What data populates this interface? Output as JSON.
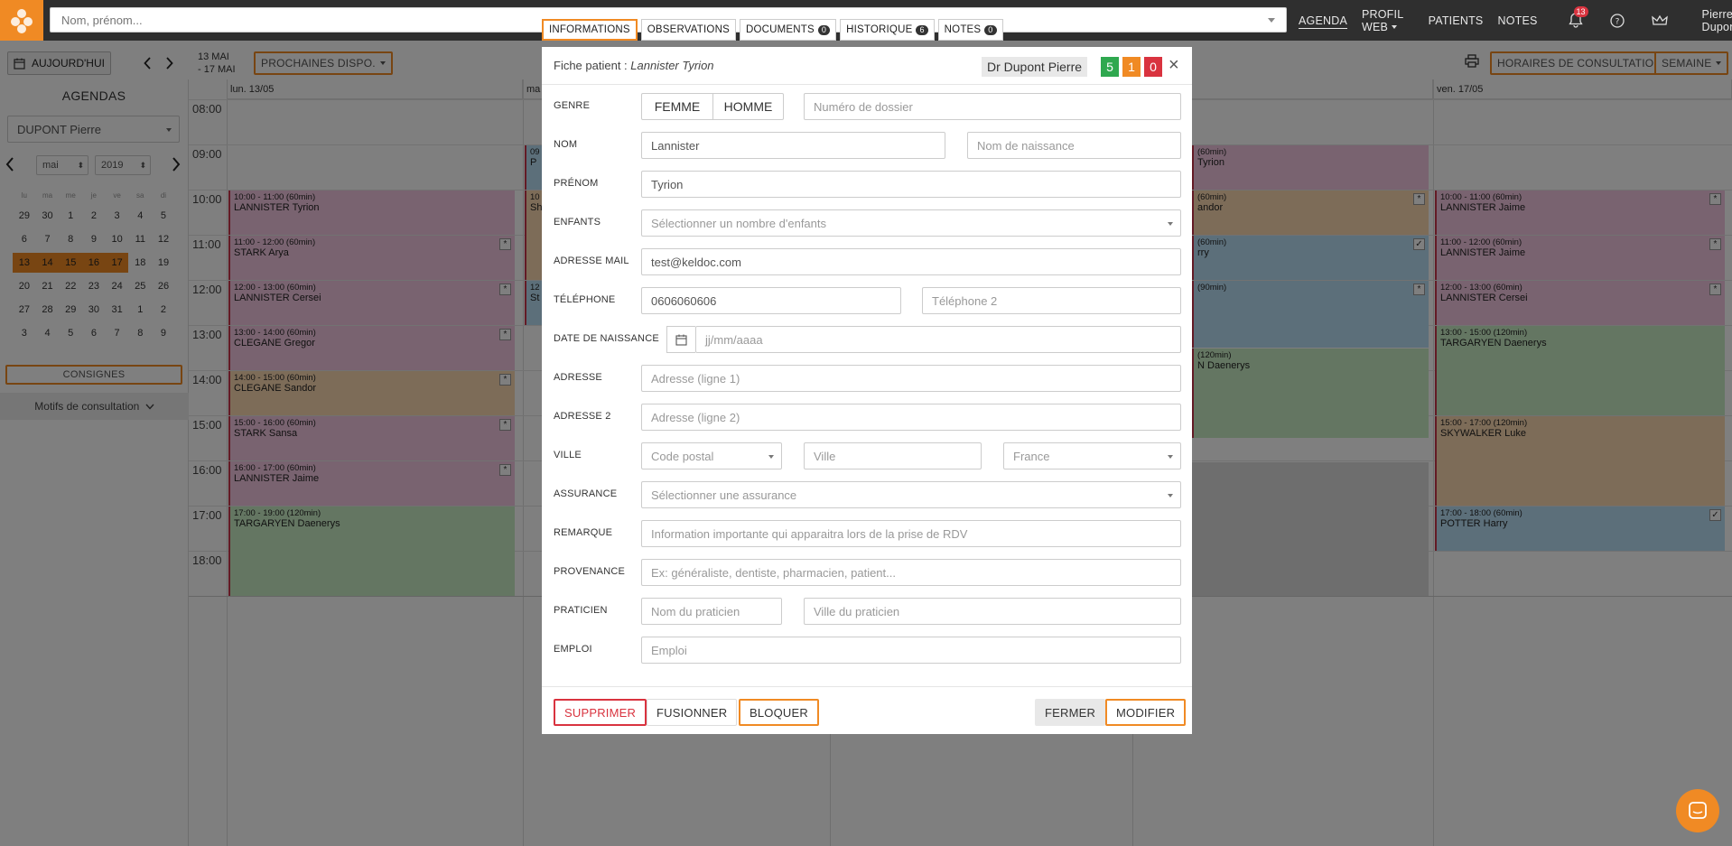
{
  "topbar": {
    "search_placeholder": "Nom, prénom...",
    "nav": [
      {
        "label": "AGENDA",
        "active": true,
        "dropdown": false
      },
      {
        "label": "PROFIL WEB",
        "active": false,
        "dropdown": true
      },
      {
        "label": "PATIENTS",
        "active": false,
        "dropdown": false
      },
      {
        "label": "NOTES",
        "active": false,
        "dropdown": false
      }
    ],
    "notifications_count": "13",
    "user_label": "Pierre Dupont",
    "icons": [
      "bell-icon",
      "help-icon",
      "crown-icon"
    ]
  },
  "toolbar": {
    "today_label": "AUJOURD'HUI",
    "range_line1": "13 MAI",
    "range_line2": "- 17 MAI",
    "next_avail_label": "PROCHAINES DISPO.",
    "hours_label": "HORAIRES DE CONSULTATION",
    "view_label": "SEMAINE"
  },
  "sidebar": {
    "title": "AGENDAS",
    "practitioner": "DUPONT Pierre",
    "month": "mai",
    "year": "2019",
    "weekday_headers": [
      "lu",
      "ma",
      "me",
      "je",
      "ve",
      "sa",
      "di"
    ],
    "weeks": [
      [
        "29",
        "30",
        "1",
        "2",
        "3",
        "4",
        "5"
      ],
      [
        "6",
        "7",
        "8",
        "9",
        "10",
        "11",
        "12"
      ],
      [
        "13",
        "14",
        "15",
        "16",
        "17",
        "18",
        "19"
      ],
      [
        "20",
        "21",
        "22",
        "23",
        "24",
        "25",
        "26"
      ],
      [
        "27",
        "28",
        "29",
        "30",
        "31",
        "1",
        "2"
      ],
      [
        "3",
        "4",
        "5",
        "6",
        "7",
        "8",
        "9"
      ]
    ],
    "selected_week_index": 2,
    "selected_days": 5,
    "consignes_label": "CONSIGNES",
    "motifs_label": "Motifs de consultation"
  },
  "calendar": {
    "hours": [
      "08:00",
      "09:00",
      "10:00",
      "11:00",
      "12:00",
      "13:00",
      "14:00",
      "15:00",
      "16:00",
      "17:00",
      "18:00"
    ],
    "days": [
      "lun. 13/05",
      "ma",
      "",
      "",
      "ven. 17/05"
    ],
    "monday_events": [
      {
        "time": "10:00 - 11:00 (60min)",
        "name": "LANNISTER Tyrion",
        "color": "pink",
        "mark": ""
      },
      {
        "time": "11:00 - 12:00 (60min)",
        "name": "STARK Arya",
        "color": "pink",
        "mark": "*"
      },
      {
        "time": "12:00 - 13:00 (60min)",
        "name": "LANNISTER Cersei",
        "color": "pink",
        "mark": "*"
      },
      {
        "time": "13:00 - 14:00 (60min)",
        "name": "CLEGANE Gregor",
        "color": "pink",
        "mark": "*"
      },
      {
        "time": "14:00 - 15:00 (60min)",
        "name": "CLEGANE Sandor",
        "color": "orange",
        "mark": "*"
      },
      {
        "time": "15:00 - 16:00 (60min)",
        "name": "STARK Sansa",
        "color": "pink",
        "mark": "*"
      },
      {
        "time": "16:00 - 17:00 (60min)",
        "name": "LANNISTER Jaime",
        "color": "pink",
        "mark": "*"
      },
      {
        "time": "17:00 - 19:00 (120min)",
        "name": "TARGARYEN Daenerys",
        "color": "green",
        "mark": ""
      }
    ],
    "tuesday_fragments": [
      {
        "time": "09",
        "name": "P",
        "color": "blue"
      },
      {
        "time": "10",
        "name": "Sh",
        "color": "orange"
      },
      {
        "time": "12",
        "name": "St",
        "color": "blue"
      }
    ],
    "thursday_fragments": [
      {
        "time": "(60min)",
        "name": "Tyrion",
        "color": "pink",
        "mark": ""
      },
      {
        "time": "(60min)",
        "name": "andor",
        "color": "orange",
        "mark": "*"
      },
      {
        "time": "(60min)",
        "name": "rry",
        "color": "blue",
        "mark": "✓"
      },
      {
        "time": "(90min)",
        "name": "",
        "color": "blue",
        "mark": "*"
      },
      {
        "time": "(120min)",
        "name": "N Daenerys",
        "color": "green",
        "mark": ""
      }
    ],
    "friday_events": [
      {
        "time": "10:00 - 11:00 (60min)",
        "name": "LANNISTER Jaime",
        "color": "pink",
        "mark": "*"
      },
      {
        "time": "11:00 - 12:00 (60min)",
        "name": "LANNISTER Jaime",
        "color": "pink",
        "mark": "*"
      },
      {
        "time": "12:00 - 13:00 (60min)",
        "name": "LANNISTER Cersei",
        "color": "pink",
        "mark": "*"
      },
      {
        "time": "13:00 - 15:00 (120min)",
        "name": "TARGARYEN Daenerys",
        "color": "green",
        "mark": ""
      },
      {
        "time": "15:00 - 17:00 (120min)",
        "name": "SKYWALKER Luke",
        "color": "orange",
        "mark": ""
      },
      {
        "time": "17:00 - 18:00 (60min)",
        "name": "POTTER Harry",
        "color": "blue",
        "mark": "✓"
      }
    ]
  },
  "modal": {
    "tabs": [
      {
        "label": "INFORMATIONS",
        "count": "",
        "active": true
      },
      {
        "label": "OBSERVATIONS",
        "count": "",
        "active": false
      },
      {
        "label": "DOCUMENTS",
        "count": "0",
        "active": false
      },
      {
        "label": "HISTORIQUE",
        "count": "6",
        "active": false
      },
      {
        "label": "NOTES",
        "count": "0",
        "active": false
      }
    ],
    "title_prefix": "Fiche patient :",
    "patient_name": "Lannister Tyrion",
    "doctor": "Dr Dupont Pierre",
    "counters": [
      {
        "value": "5",
        "color": "#2fa84f"
      },
      {
        "value": "1",
        "color": "#f08a24"
      },
      {
        "value": "0",
        "color": "#d9333f"
      }
    ],
    "fields": {
      "genre": {
        "label": "GENRE",
        "female": "FEMME",
        "male": "HOMME",
        "file_placeholder": "Numéro de dossier"
      },
      "nom": {
        "label": "NOM",
        "value": "Lannister",
        "birth_placeholder": "Nom de naissance"
      },
      "prenom": {
        "label": "PRÉNOM",
        "value": "Tyrion"
      },
      "enfants": {
        "label": "ENFANTS",
        "placeholder": "Sélectionner un nombre d'enfants"
      },
      "email": {
        "label": "ADRESSE MAIL",
        "value": "test@keldoc.com"
      },
      "telephone": {
        "label": "TÉLÉPHONE",
        "value": "0606060606",
        "phone2_placeholder": "Téléphone 2"
      },
      "naissance": {
        "label": "DATE DE NAISSANCE",
        "placeholder": "jj/mm/aaaa"
      },
      "adresse": {
        "label": "ADRESSE",
        "placeholder": "Adresse (ligne 1)"
      },
      "adresse2": {
        "label": "ADRESSE 2",
        "placeholder": "Adresse (ligne 2)"
      },
      "ville": {
        "label": "VILLE",
        "postal_placeholder": "Code postal",
        "city_placeholder": "Ville",
        "country": "France"
      },
      "assurance": {
        "label": "ASSURANCE",
        "placeholder": "Sélectionner une assurance"
      },
      "remarque": {
        "label": "REMARQUE",
        "placeholder": "Information importante qui apparaitra lors de la prise de RDV"
      },
      "provenance": {
        "label": "PROVENANCE",
        "placeholder": "Ex: généraliste, dentiste, pharmacien, patient..."
      },
      "praticien": {
        "label": "PRATICIEN",
        "name_placeholder": "Nom du praticien",
        "city_placeholder": "Ville du praticien"
      },
      "emploi": {
        "label": "EMPLOI",
        "placeholder": "Emploi"
      }
    },
    "footer": {
      "delete": "SUPPRIMER",
      "merge": "FUSIONNER",
      "block": "BLOQUER",
      "close": "FERMER",
      "edit": "MODIFIER"
    }
  }
}
